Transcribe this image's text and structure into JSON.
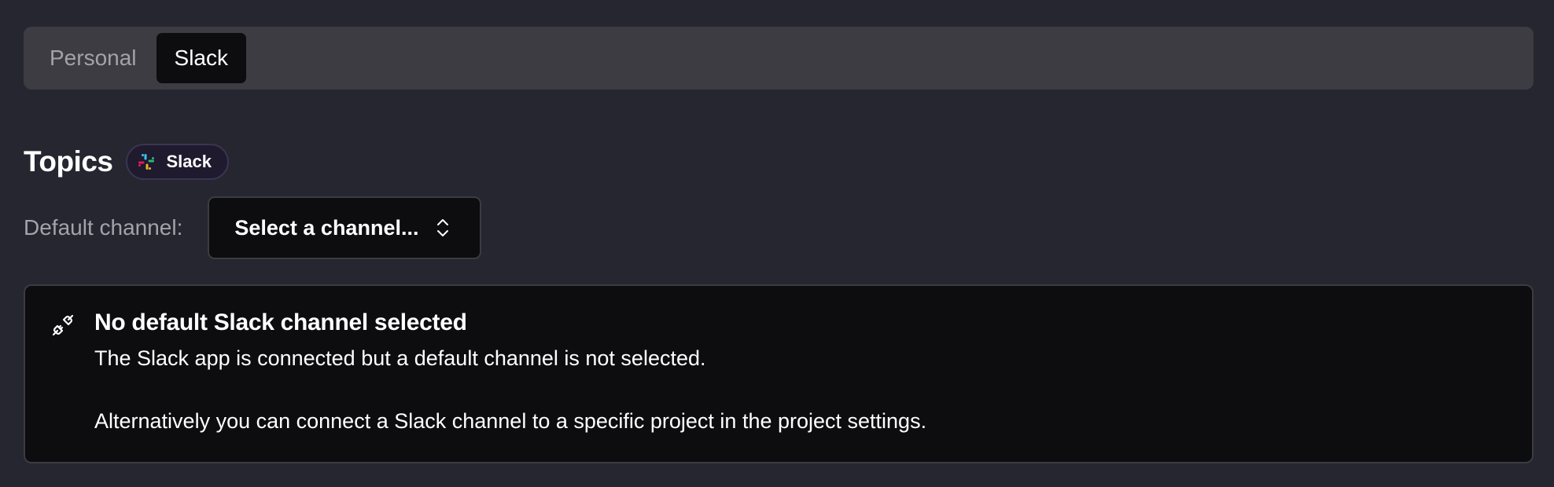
{
  "tabs": [
    {
      "label": "Personal",
      "active": false
    },
    {
      "label": "Slack",
      "active": true
    }
  ],
  "section": {
    "title": "Topics",
    "badge": {
      "label": "Slack",
      "icon": "slack-logo-icon"
    }
  },
  "default_channel": {
    "label": "Default channel:",
    "select_value": "Select a channel...",
    "icon": "chevron-up-down-icon"
  },
  "alert": {
    "icon": "unplugged-icon",
    "title": "No default Slack channel selected",
    "line1": "The Slack app is connected but a default channel is not selected.",
    "line2": "Alternatively you can connect a Slack channel to a specific project in the project settings."
  },
  "colors": {
    "background": "#252630",
    "tabbar": "#3c3c42",
    "panel": "#0d0d10",
    "muted_text": "#a3a3aa",
    "border": "#3b3b42"
  }
}
